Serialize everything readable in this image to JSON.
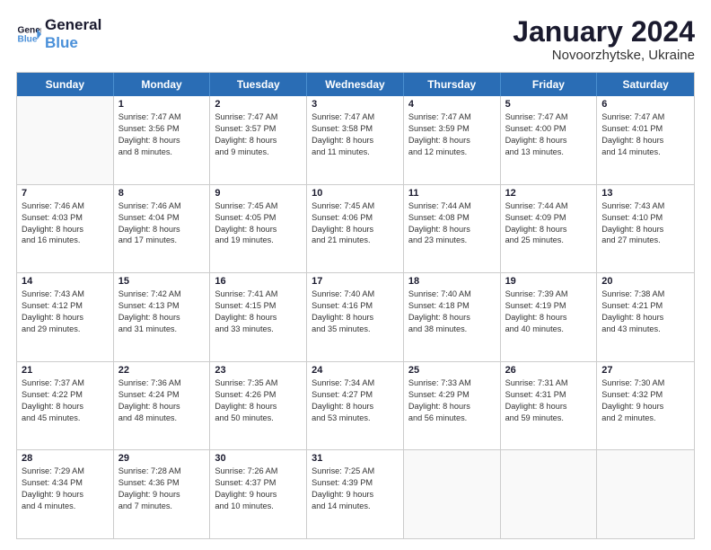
{
  "logo": {
    "line1": "General",
    "line2": "Blue"
  },
  "title": "January 2024",
  "subtitle": "Novoorzhytske, Ukraine",
  "headers": [
    "Sunday",
    "Monday",
    "Tuesday",
    "Wednesday",
    "Thursday",
    "Friday",
    "Saturday"
  ],
  "rows": [
    [
      {
        "day": "",
        "lines": []
      },
      {
        "day": "1",
        "lines": [
          "Sunrise: 7:47 AM",
          "Sunset: 3:56 PM",
          "Daylight: 8 hours",
          "and 8 minutes."
        ]
      },
      {
        "day": "2",
        "lines": [
          "Sunrise: 7:47 AM",
          "Sunset: 3:57 PM",
          "Daylight: 8 hours",
          "and 9 minutes."
        ]
      },
      {
        "day": "3",
        "lines": [
          "Sunrise: 7:47 AM",
          "Sunset: 3:58 PM",
          "Daylight: 8 hours",
          "and 11 minutes."
        ]
      },
      {
        "day": "4",
        "lines": [
          "Sunrise: 7:47 AM",
          "Sunset: 3:59 PM",
          "Daylight: 8 hours",
          "and 12 minutes."
        ]
      },
      {
        "day": "5",
        "lines": [
          "Sunrise: 7:47 AM",
          "Sunset: 4:00 PM",
          "Daylight: 8 hours",
          "and 13 minutes."
        ]
      },
      {
        "day": "6",
        "lines": [
          "Sunrise: 7:47 AM",
          "Sunset: 4:01 PM",
          "Daylight: 8 hours",
          "and 14 minutes."
        ]
      }
    ],
    [
      {
        "day": "7",
        "lines": [
          "Sunrise: 7:46 AM",
          "Sunset: 4:03 PM",
          "Daylight: 8 hours",
          "and 16 minutes."
        ]
      },
      {
        "day": "8",
        "lines": [
          "Sunrise: 7:46 AM",
          "Sunset: 4:04 PM",
          "Daylight: 8 hours",
          "and 17 minutes."
        ]
      },
      {
        "day": "9",
        "lines": [
          "Sunrise: 7:45 AM",
          "Sunset: 4:05 PM",
          "Daylight: 8 hours",
          "and 19 minutes."
        ]
      },
      {
        "day": "10",
        "lines": [
          "Sunrise: 7:45 AM",
          "Sunset: 4:06 PM",
          "Daylight: 8 hours",
          "and 21 minutes."
        ]
      },
      {
        "day": "11",
        "lines": [
          "Sunrise: 7:44 AM",
          "Sunset: 4:08 PM",
          "Daylight: 8 hours",
          "and 23 minutes."
        ]
      },
      {
        "day": "12",
        "lines": [
          "Sunrise: 7:44 AM",
          "Sunset: 4:09 PM",
          "Daylight: 8 hours",
          "and 25 minutes."
        ]
      },
      {
        "day": "13",
        "lines": [
          "Sunrise: 7:43 AM",
          "Sunset: 4:10 PM",
          "Daylight: 8 hours",
          "and 27 minutes."
        ]
      }
    ],
    [
      {
        "day": "14",
        "lines": [
          "Sunrise: 7:43 AM",
          "Sunset: 4:12 PM",
          "Daylight: 8 hours",
          "and 29 minutes."
        ]
      },
      {
        "day": "15",
        "lines": [
          "Sunrise: 7:42 AM",
          "Sunset: 4:13 PM",
          "Daylight: 8 hours",
          "and 31 minutes."
        ]
      },
      {
        "day": "16",
        "lines": [
          "Sunrise: 7:41 AM",
          "Sunset: 4:15 PM",
          "Daylight: 8 hours",
          "and 33 minutes."
        ]
      },
      {
        "day": "17",
        "lines": [
          "Sunrise: 7:40 AM",
          "Sunset: 4:16 PM",
          "Daylight: 8 hours",
          "and 35 minutes."
        ]
      },
      {
        "day": "18",
        "lines": [
          "Sunrise: 7:40 AM",
          "Sunset: 4:18 PM",
          "Daylight: 8 hours",
          "and 38 minutes."
        ]
      },
      {
        "day": "19",
        "lines": [
          "Sunrise: 7:39 AM",
          "Sunset: 4:19 PM",
          "Daylight: 8 hours",
          "and 40 minutes."
        ]
      },
      {
        "day": "20",
        "lines": [
          "Sunrise: 7:38 AM",
          "Sunset: 4:21 PM",
          "Daylight: 8 hours",
          "and 43 minutes."
        ]
      }
    ],
    [
      {
        "day": "21",
        "lines": [
          "Sunrise: 7:37 AM",
          "Sunset: 4:22 PM",
          "Daylight: 8 hours",
          "and 45 minutes."
        ]
      },
      {
        "day": "22",
        "lines": [
          "Sunrise: 7:36 AM",
          "Sunset: 4:24 PM",
          "Daylight: 8 hours",
          "and 48 minutes."
        ]
      },
      {
        "day": "23",
        "lines": [
          "Sunrise: 7:35 AM",
          "Sunset: 4:26 PM",
          "Daylight: 8 hours",
          "and 50 minutes."
        ]
      },
      {
        "day": "24",
        "lines": [
          "Sunrise: 7:34 AM",
          "Sunset: 4:27 PM",
          "Daylight: 8 hours",
          "and 53 minutes."
        ]
      },
      {
        "day": "25",
        "lines": [
          "Sunrise: 7:33 AM",
          "Sunset: 4:29 PM",
          "Daylight: 8 hours",
          "and 56 minutes."
        ]
      },
      {
        "day": "26",
        "lines": [
          "Sunrise: 7:31 AM",
          "Sunset: 4:31 PM",
          "Daylight: 8 hours",
          "and 59 minutes."
        ]
      },
      {
        "day": "27",
        "lines": [
          "Sunrise: 7:30 AM",
          "Sunset: 4:32 PM",
          "Daylight: 9 hours",
          "and 2 minutes."
        ]
      }
    ],
    [
      {
        "day": "28",
        "lines": [
          "Sunrise: 7:29 AM",
          "Sunset: 4:34 PM",
          "Daylight: 9 hours",
          "and 4 minutes."
        ]
      },
      {
        "day": "29",
        "lines": [
          "Sunrise: 7:28 AM",
          "Sunset: 4:36 PM",
          "Daylight: 9 hours",
          "and 7 minutes."
        ]
      },
      {
        "day": "30",
        "lines": [
          "Sunrise: 7:26 AM",
          "Sunset: 4:37 PM",
          "Daylight: 9 hours",
          "and 10 minutes."
        ]
      },
      {
        "day": "31",
        "lines": [
          "Sunrise: 7:25 AM",
          "Sunset: 4:39 PM",
          "Daylight: 9 hours",
          "and 14 minutes."
        ]
      },
      {
        "day": "",
        "lines": []
      },
      {
        "day": "",
        "lines": []
      },
      {
        "day": "",
        "lines": []
      }
    ]
  ]
}
